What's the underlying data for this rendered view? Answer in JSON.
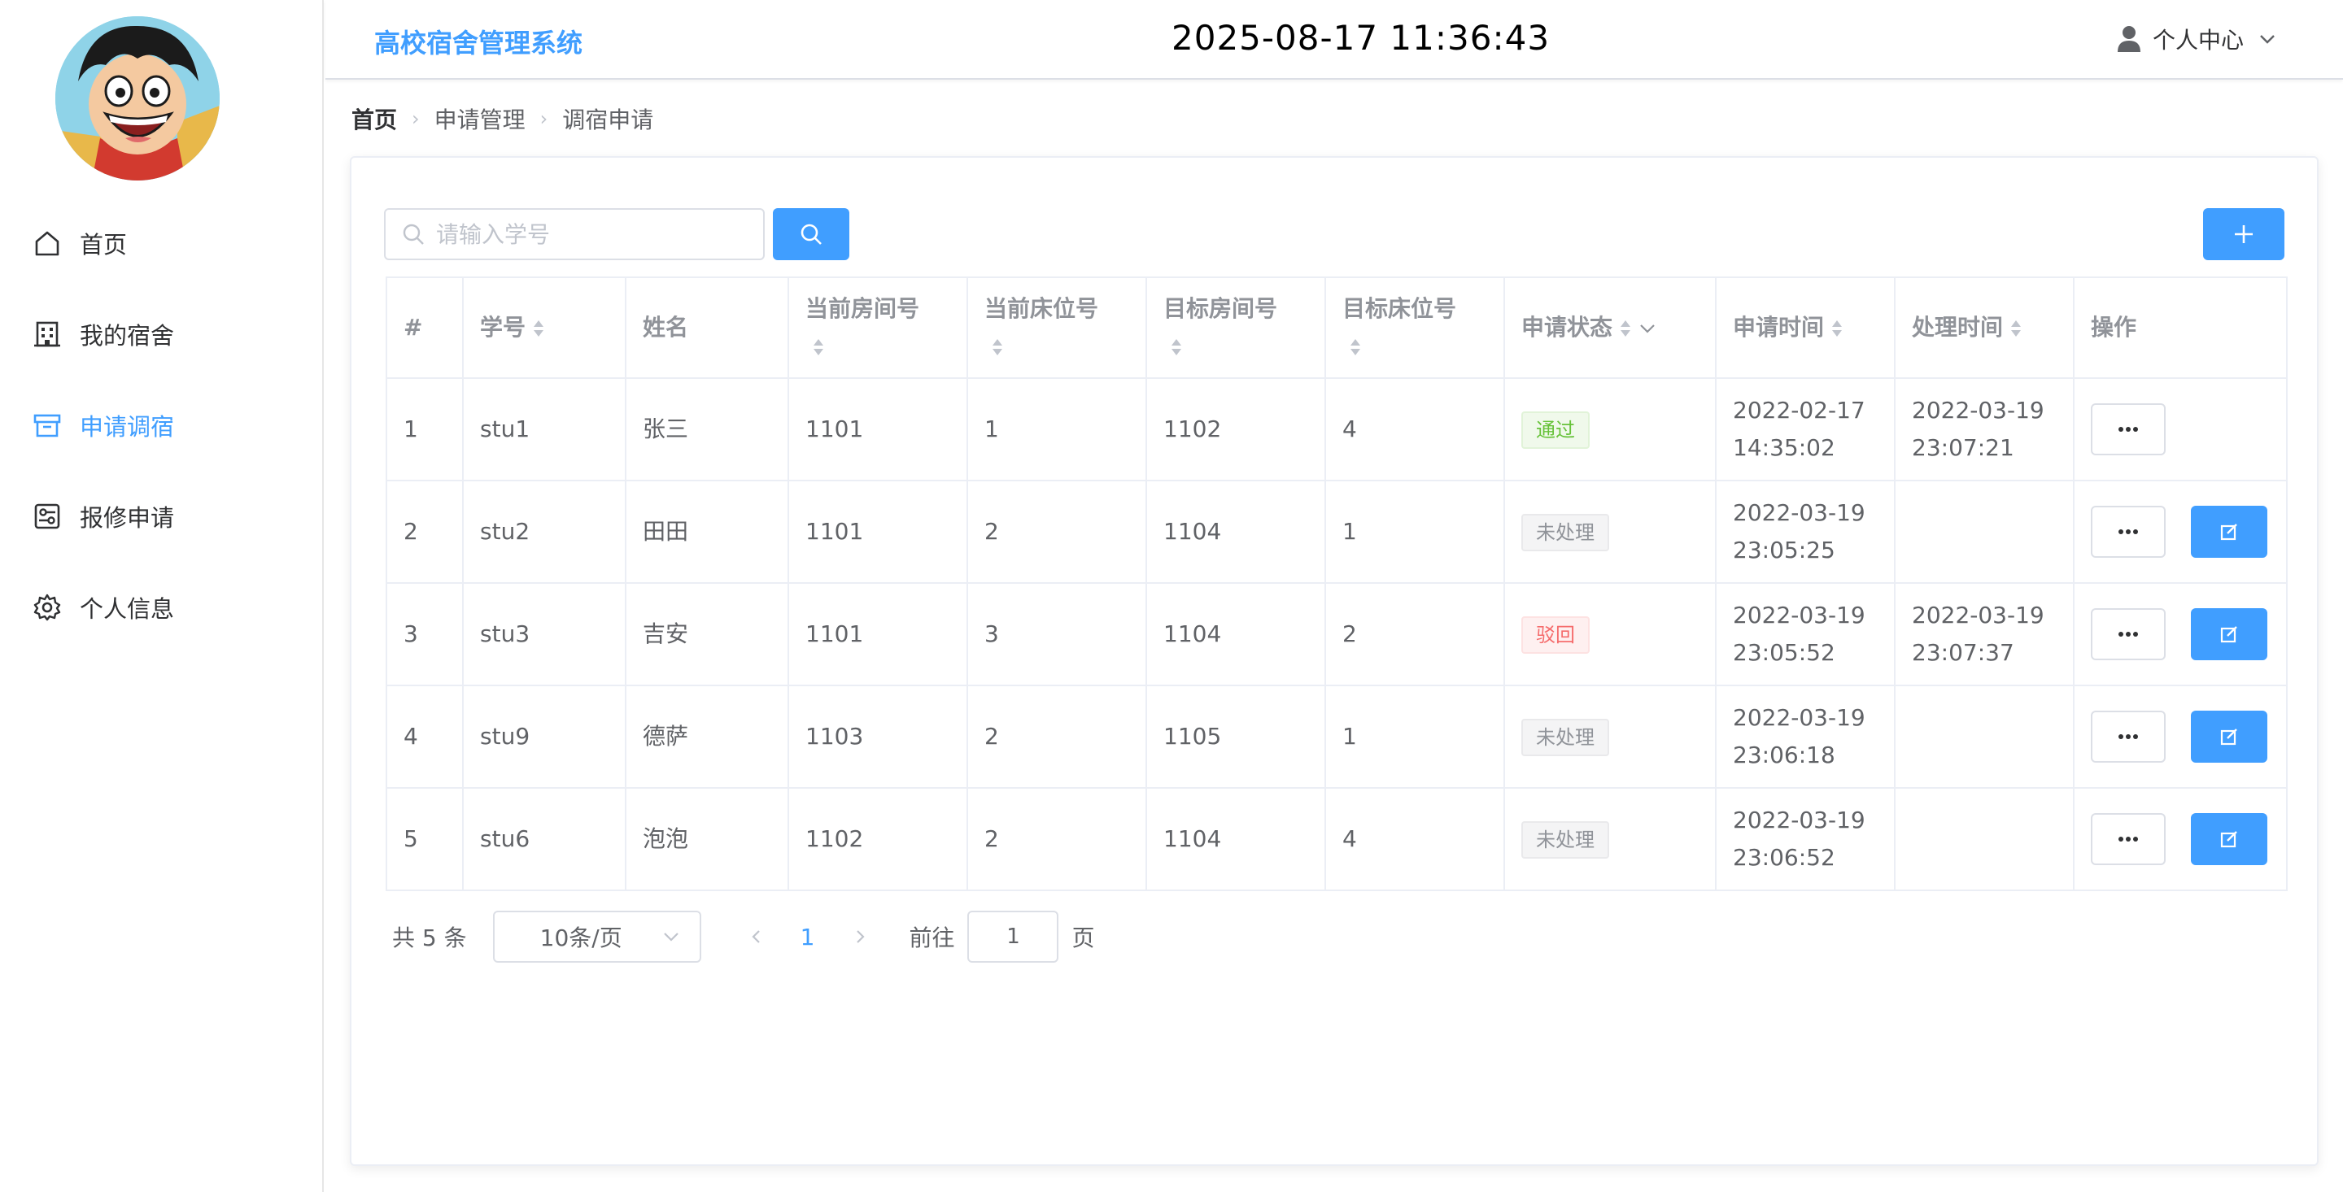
{
  "header": {
    "app_title": "高校宿舍管理系统",
    "clock": "2025-08-17 11:36:43",
    "user_menu_label": "个人中心"
  },
  "sidebar": {
    "items": [
      {
        "label": "首页",
        "icon": "home-icon",
        "active": false
      },
      {
        "label": "我的宿舍",
        "icon": "building-icon",
        "active": false
      },
      {
        "label": "申请调宿",
        "icon": "box-icon",
        "active": true
      },
      {
        "label": "报修申请",
        "icon": "repair-icon",
        "active": false
      },
      {
        "label": "个人信息",
        "icon": "gear-icon",
        "active": false
      }
    ]
  },
  "breadcrumb": [
    "首页",
    "申请管理",
    "调宿申请"
  ],
  "search": {
    "placeholder": "请输入学号",
    "value": ""
  },
  "table": {
    "headers": {
      "index": "#",
      "stu_no": "学号",
      "name": "姓名",
      "cur_room": "当前房间号",
      "cur_bed": "当前床位号",
      "target_room": "目标房间号",
      "target_bed": "目标床位号",
      "status": "申请状态",
      "apply_time": "申请时间",
      "handle_time": "处理时间",
      "ops": "操作"
    },
    "rows": [
      {
        "index": "1",
        "stu_no": "stu1",
        "name": "张三",
        "cur_room": "1101",
        "cur_bed": "1",
        "target_room": "1102",
        "target_bed": "4",
        "status": "通过",
        "status_type": "success",
        "apply_date": "2022-02-17",
        "apply_clock": "14:35:02",
        "handle_date": "2022-03-19",
        "handle_clock": "23:07:21",
        "editable": false
      },
      {
        "index": "2",
        "stu_no": "stu2",
        "name": "田田",
        "cur_room": "1101",
        "cur_bed": "2",
        "target_room": "1104",
        "target_bed": "1",
        "status": "未处理",
        "status_type": "info",
        "apply_date": "2022-03-19",
        "apply_clock": "23:05:25",
        "handle_date": "",
        "handle_clock": "",
        "editable": true
      },
      {
        "index": "3",
        "stu_no": "stu3",
        "name": "吉安",
        "cur_room": "1101",
        "cur_bed": "3",
        "target_room": "1104",
        "target_bed": "2",
        "status": "驳回",
        "status_type": "danger",
        "apply_date": "2022-03-19",
        "apply_clock": "23:05:52",
        "handle_date": "2022-03-19",
        "handle_clock": "23:07:37",
        "editable": true
      },
      {
        "index": "4",
        "stu_no": "stu9",
        "name": "德萨",
        "cur_room": "1103",
        "cur_bed": "2",
        "target_room": "1105",
        "target_bed": "1",
        "status": "未处理",
        "status_type": "info",
        "apply_date": "2022-03-19",
        "apply_clock": "23:06:18",
        "handle_date": "",
        "handle_clock": "",
        "editable": true
      },
      {
        "index": "5",
        "stu_no": "stu6",
        "name": "泡泡",
        "cur_room": "1102",
        "cur_bed": "2",
        "target_room": "1104",
        "target_bed": "4",
        "status": "未处理",
        "status_type": "info",
        "apply_date": "2022-03-19",
        "apply_clock": "23:06:52",
        "handle_date": "",
        "handle_clock": "",
        "editable": true
      }
    ]
  },
  "pagination": {
    "total": "共 5 条",
    "page_size": "10条/页",
    "current_page": "1",
    "goto_label": "前往",
    "goto_value": "1",
    "goto_suffix": "页"
  },
  "colors": {
    "accent": "#409eff",
    "success": "#67c23a",
    "danger": "#f56c6c",
    "info": "#909399"
  }
}
